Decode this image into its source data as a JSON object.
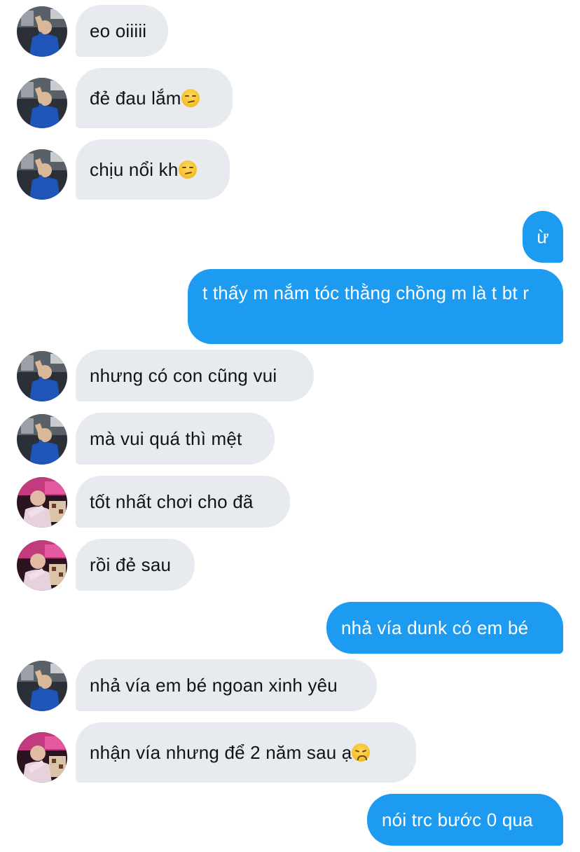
{
  "conversation": {
    "messages": [
      {
        "from": "other",
        "avatar": "avatar-blue-shirt",
        "text": "eo oiiiii"
      },
      {
        "from": "other",
        "avatar": "avatar-blue-shirt",
        "text": "đẻ đau lắm",
        "emoji": "smirking-face-emoji"
      },
      {
        "from": "other",
        "avatar": "avatar-blue-shirt",
        "text": "chịu nổi kh",
        "emoji": "smirking-face-emoji"
      },
      {
        "from": "self",
        "text": "ừ"
      },
      {
        "from": "self",
        "text": "t thấy m nắm tóc thằng chồng m là t bt r"
      },
      {
        "from": "other",
        "avatar": "avatar-blue-shirt",
        "text": "nhưng có con cũng vui"
      },
      {
        "from": "other",
        "avatar": "avatar-blue-shirt",
        "text": "mà vui quá thì mệt"
      },
      {
        "from": "other",
        "avatar": "avatar-pink-neon",
        "text": "tốt nhất chơi cho đã"
      },
      {
        "from": "other",
        "avatar": "avatar-pink-neon",
        "text": "rồi đẻ sau"
      },
      {
        "from": "self",
        "text": "nhả vía dunk có em bé"
      },
      {
        "from": "other",
        "avatar": "avatar-blue-shirt",
        "text": "nhả vía em bé ngoan xinh yêu"
      },
      {
        "from": "other",
        "avatar": "avatar-pink-neon",
        "text": "nhận vía nhưng để 2 năm sau ạ",
        "emoji": "disappointed-face-emoji"
      },
      {
        "from": "self",
        "text": "nói trc bước 0 qua"
      }
    ]
  },
  "colors": {
    "incoming_bubble": "#e7ebef",
    "outgoing_bubble": "#1d9bf0",
    "incoming_text": "#0f1419",
    "outgoing_text": "#ffffff"
  }
}
